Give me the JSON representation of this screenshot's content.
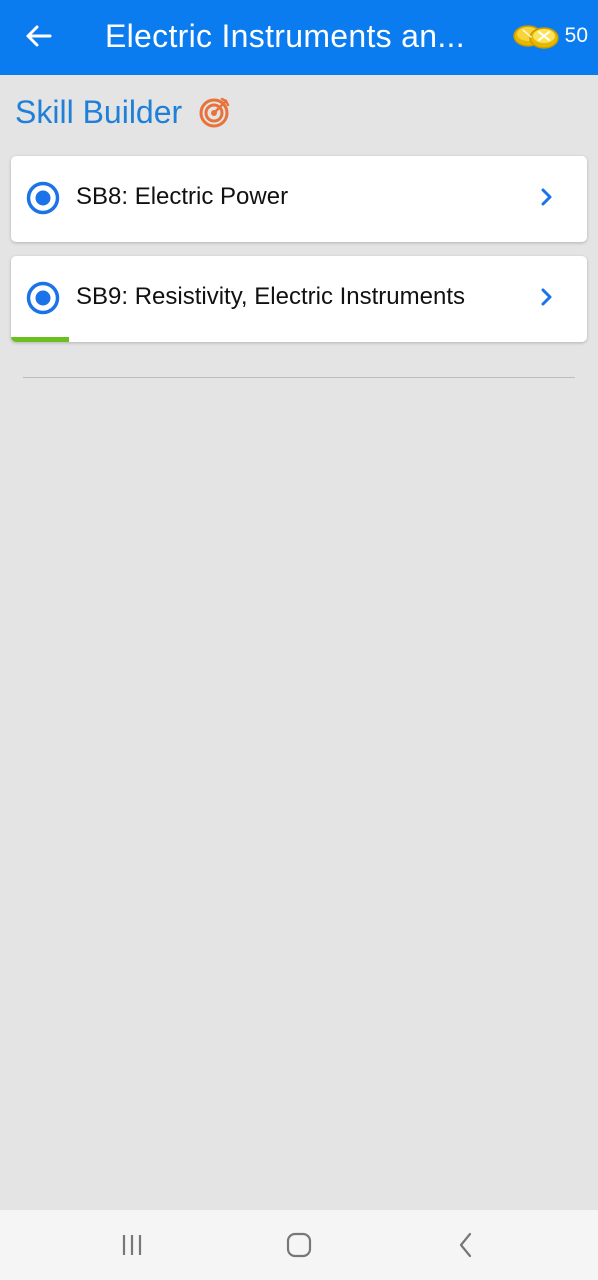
{
  "app_bar": {
    "title": "Electric Instruments an...",
    "coin_count": "50",
    "back_icon": "arrow-left-icon",
    "coin_icon": "gold-coins-icon"
  },
  "section": {
    "title": "Skill Builder",
    "icon": "target-icon",
    "icon_color": "#e8733a",
    "title_color": "#1f7fd9"
  },
  "items": [
    {
      "label": "SB8: Electric Power",
      "selected": true,
      "progress_percent": 0
    },
    {
      "label": "SB9: Resistivity, Electric Instruments",
      "selected": true,
      "progress_percent": 10
    }
  ],
  "colors": {
    "app_bar": "#0a7cf0",
    "background": "#e4e4e4",
    "accent": "#1a73e8",
    "progress": "#6cbf21"
  },
  "system_nav": {
    "recents_icon": "recents-icon",
    "home_icon": "home-icon",
    "back_icon": "back-chevron-icon"
  }
}
